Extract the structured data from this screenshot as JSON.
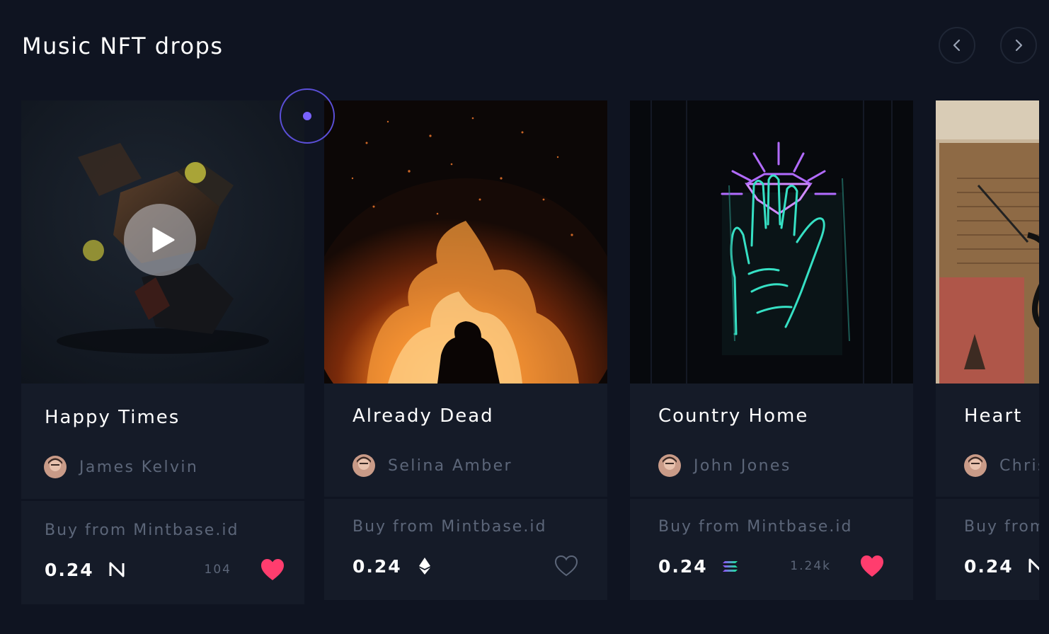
{
  "header": {
    "title": "Music NFT drops",
    "prev_icon": "chevron-left-icon",
    "next_icon": "chevron-right-icon"
  },
  "cards": [
    {
      "title": "Happy Times",
      "artist": "James Kelvin",
      "buy_label": "Buy from Mintbase.id",
      "price": "0.24",
      "currency_icon": "near-icon",
      "likes": "104",
      "liked": true,
      "has_play_button": true
    },
    {
      "title": "Already Dead",
      "artist": "Selina Amber",
      "buy_label": "Buy from Mintbase.id",
      "price": "0.24",
      "currency_icon": "ethereum-icon",
      "likes": "",
      "liked": false
    },
    {
      "title": "Country Home",
      "artist": "John Jones",
      "buy_label": "Buy from Mintbase.id",
      "price": "0.24",
      "currency_icon": "solana-icon",
      "likes": "1.24k",
      "liked": true
    },
    {
      "title": "Heart",
      "artist": "Chris",
      "buy_label": "Buy from Mintbase.id",
      "price": "0.24",
      "currency_icon": "near-icon",
      "likes": "",
      "liked": false
    }
  ],
  "colors": {
    "background": "#0f1421",
    "card": "#151b28",
    "muted_text": "#5c6679",
    "heart": "#ff3d6e",
    "cursor": "#7a63ff"
  }
}
